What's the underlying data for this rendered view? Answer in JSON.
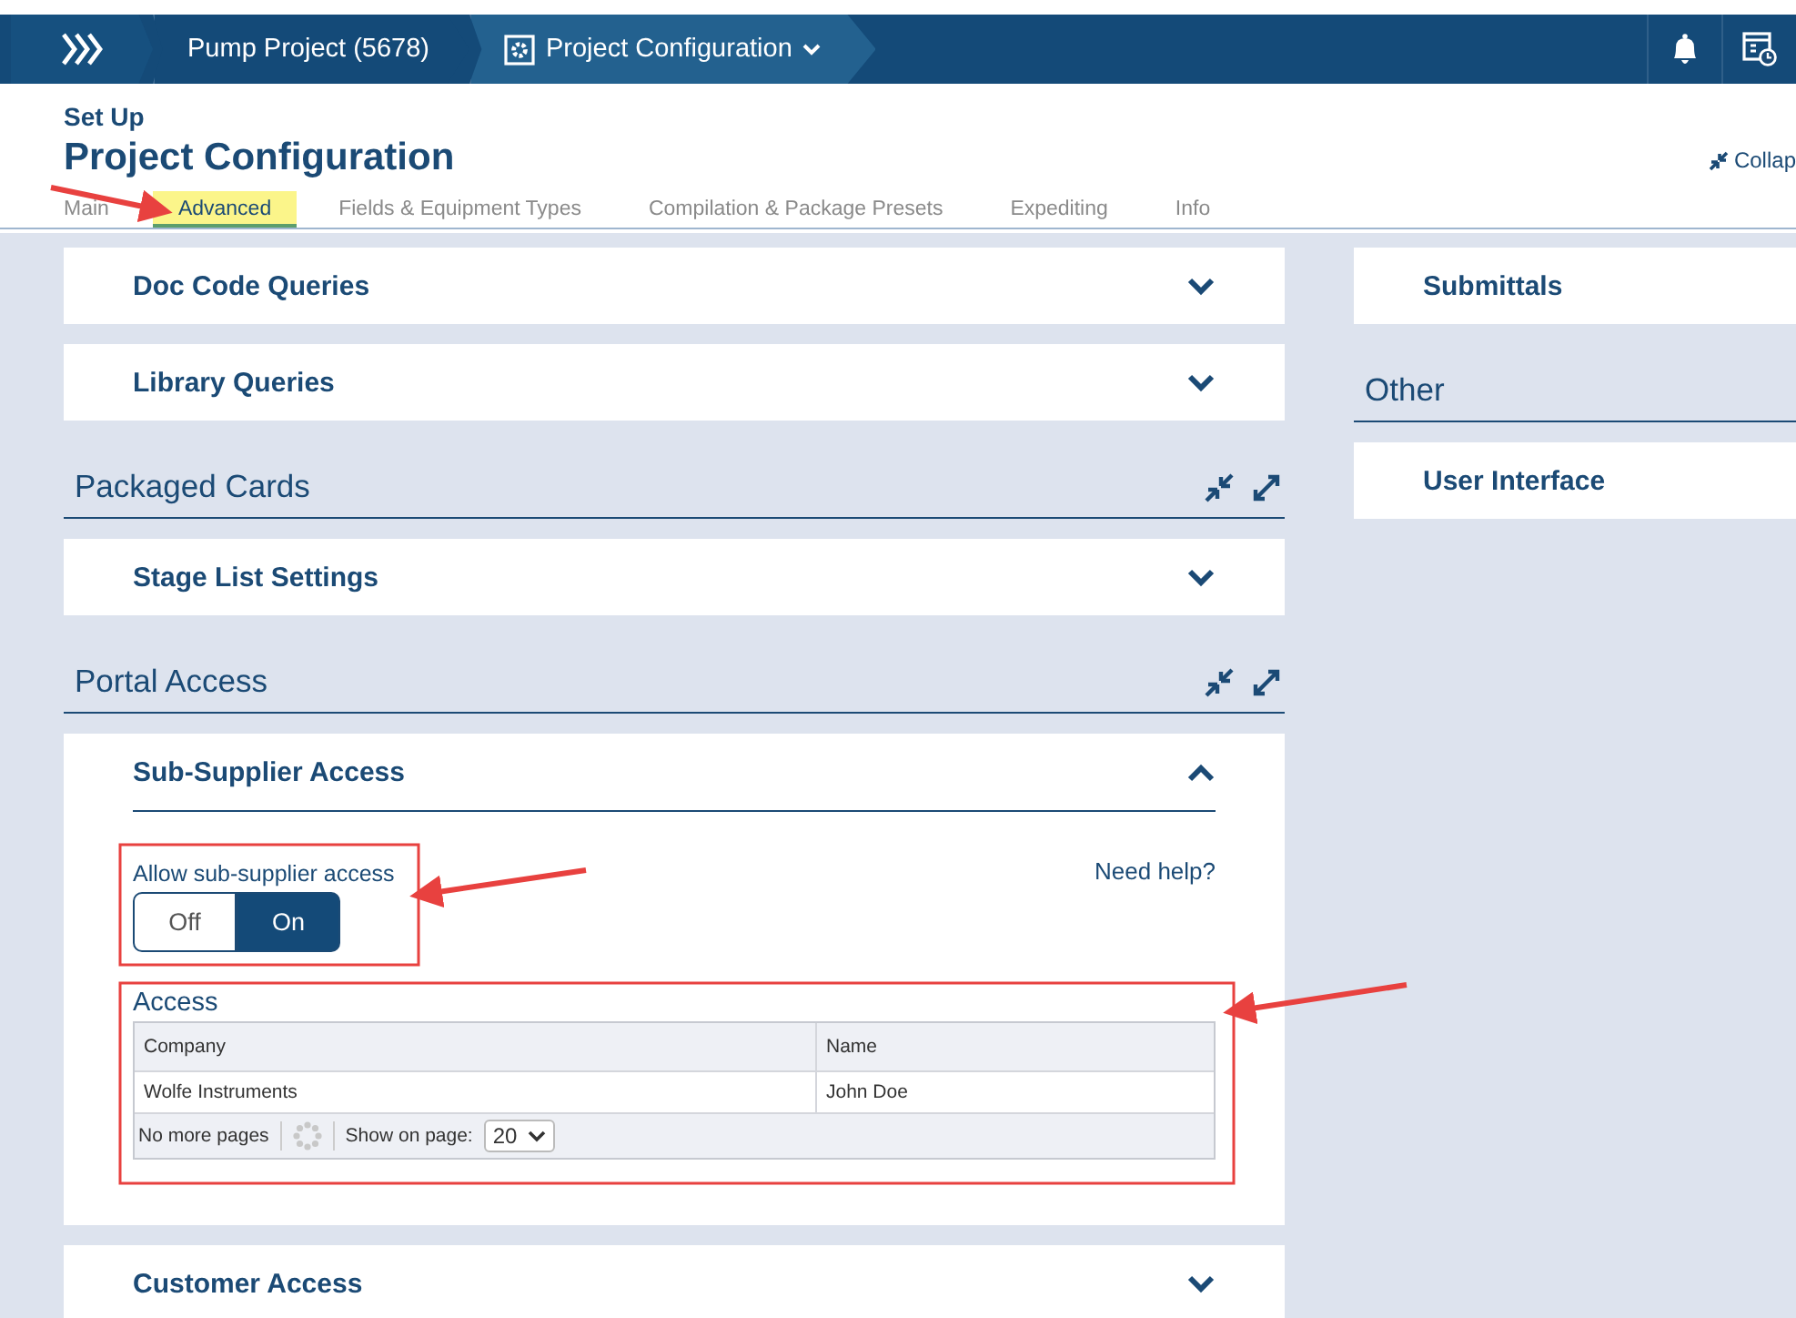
{
  "nav": {
    "breadcrumbs": [
      {
        "label": "Pump Project (5678)",
        "selected": false
      },
      {
        "label": "Project Configuration",
        "selected": true
      }
    ]
  },
  "header": {
    "eyebrow": "Set Up",
    "title": "Project Configuration",
    "collapse_link": "Collap"
  },
  "tabs": [
    {
      "label": "Main",
      "selected": false
    },
    {
      "label": "Advanced",
      "selected": true
    },
    {
      "label": "Fields & Equipment Types",
      "selected": false
    },
    {
      "label": "Compilation & Package Presets",
      "selected": false
    },
    {
      "label": "Expediting",
      "selected": false
    },
    {
      "label": "Info",
      "selected": false
    }
  ],
  "left_column": [
    {
      "kind": "card",
      "title": "Doc Code Queries",
      "expanded": false
    },
    {
      "kind": "card",
      "title": "Library Queries",
      "expanded": false
    },
    {
      "kind": "section",
      "title": "Packaged Cards",
      "controls": true
    },
    {
      "kind": "card",
      "title": "Stage List Settings",
      "expanded": false
    },
    {
      "kind": "section",
      "title": "Portal Access",
      "controls": true
    },
    {
      "kind": "card",
      "title": "Sub-Supplier Access",
      "expanded": true,
      "content": {
        "toggle": {
          "label": "Allow sub-supplier access",
          "options": [
            {
              "label": "Off",
              "selected": false
            },
            {
              "label": "On",
              "selected": true
            }
          ]
        },
        "help_link": "Need help?",
        "access": {
          "title": "Access",
          "columns": [
            "Company",
            "Name"
          ],
          "rows": [
            [
              "Wolfe Instruments",
              "John Doe"
            ]
          ],
          "footer": {
            "status": "No more pages",
            "page_size_label": "Show on page:",
            "page_size": "20"
          }
        }
      }
    },
    {
      "kind": "card",
      "title": "Customer Access",
      "expanded": false
    }
  ],
  "right_column": [
    {
      "kind": "card",
      "title": "Submittals",
      "expanded": false
    },
    {
      "kind": "section",
      "title": "Other",
      "controls": false
    },
    {
      "kind": "card",
      "title": "User Interface",
      "expanded": false
    }
  ]
}
